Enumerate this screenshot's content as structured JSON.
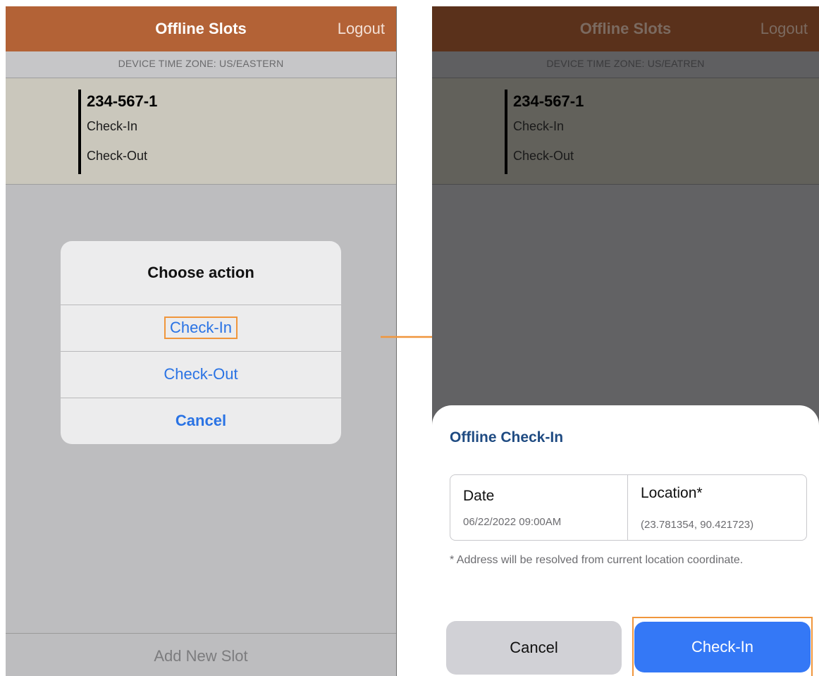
{
  "left_screen": {
    "header": {
      "title": "Offline Slots",
      "logout": "Logout"
    },
    "timezone": "DEVICE TIME ZONE: US/EASTERN",
    "slot": {
      "number": "234-567-1",
      "check_in": "Check-In",
      "check_out": "Check-Out"
    },
    "dialog": {
      "title": "Choose action",
      "options": [
        "Check-In",
        "Check-Out",
        "Cancel"
      ],
      "highlighted": "Check-In"
    },
    "footer": "Add New Slot"
  },
  "right_screen": {
    "header": {
      "title": "Offline Slots",
      "logout": "Logout"
    },
    "timezone": "DEVICE TIME ZONE: US/EATREN",
    "slot": {
      "number": "234-567-1",
      "check_in": "Check-In",
      "check_out": "Check-Out"
    },
    "sheet": {
      "title": "Offline Check-In",
      "date_label": "Date",
      "date_value": "06/22/2022 09:00AM",
      "location_label": "Location*",
      "location_value": "(23.781354, 90.421723)",
      "note": "* Address will be resolved from current location coordinate.",
      "cancel": "Cancel",
      "confirm": "Check-In"
    }
  },
  "colors": {
    "header": "#b36236",
    "accent_blue": "#2a73e4",
    "button_blue": "#3478f6",
    "highlight": "#f0963c",
    "sheet_title": "#1f4b82"
  }
}
